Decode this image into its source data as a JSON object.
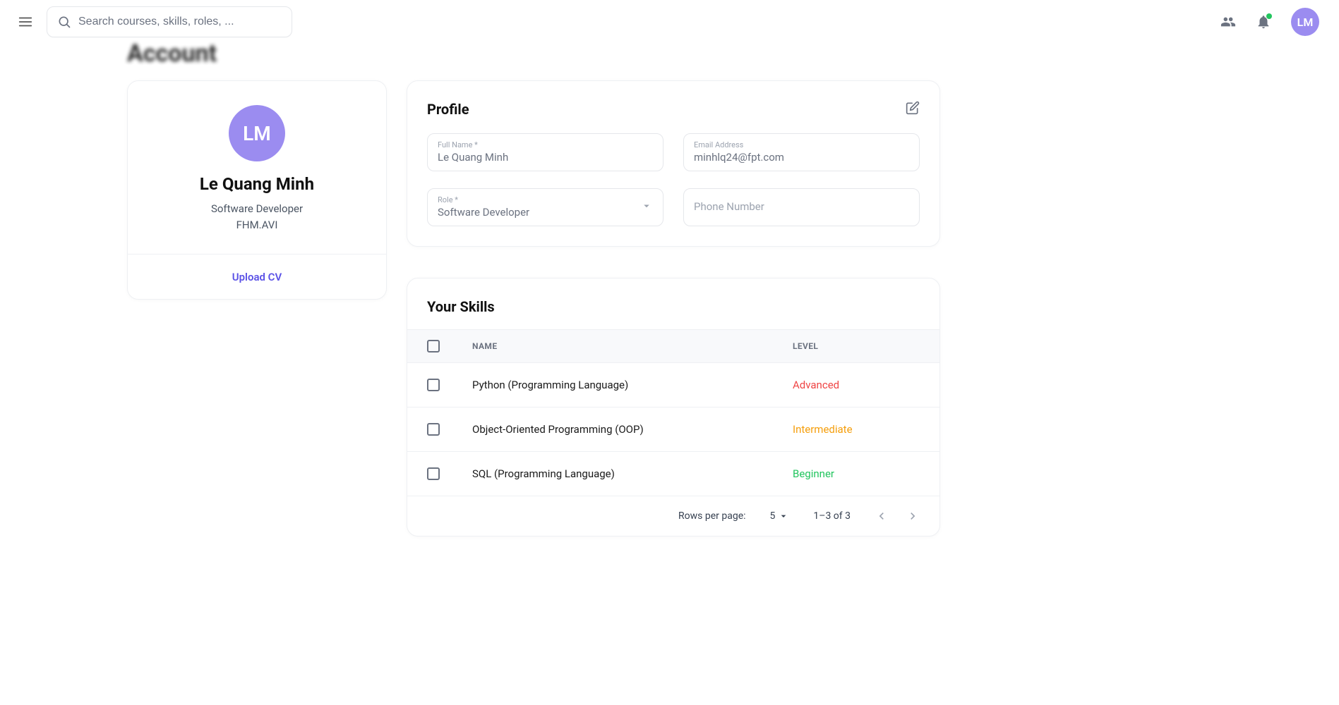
{
  "header": {
    "search_placeholder": "Search courses, skills, roles, ...",
    "avatar_initials": "LM"
  },
  "page": {
    "title": "Account"
  },
  "mini": {
    "avatar_initials": "LM",
    "name": "Le Quang Minh",
    "role": "Software Developer",
    "org": "FHM.AVI",
    "upload_label": "Upload CV"
  },
  "profile": {
    "title": "Profile",
    "full_name_label": "Full Name *",
    "full_name_value": "Le Quang Minh",
    "email_label": "Email Address",
    "email_value": "minhlq24@fpt.com",
    "role_label": "Role *",
    "role_value": "Software Developer",
    "phone_placeholder": "Phone Number"
  },
  "skills": {
    "title": "Your Skills",
    "columns": {
      "name": "NAME",
      "level": "LEVEL"
    },
    "rows": [
      {
        "name": "Python (Programming Language)",
        "level": "Advanced",
        "level_class": "level-advanced"
      },
      {
        "name": "Object-Oriented Programming (OOP)",
        "level": "Intermediate",
        "level_class": "level-intermediate"
      },
      {
        "name": "SQL (Programming Language)",
        "level": "Beginner",
        "level_class": "level-beginner"
      }
    ],
    "pager": {
      "rows_per_page_label": "Rows per page:",
      "rows_per_page_value": "5",
      "range_text": "1–3 of 3"
    }
  },
  "colors": {
    "accent": "#9b8cf0",
    "link": "#5b52e6",
    "advanced": "#ef4444",
    "intermediate": "#f59e0b",
    "beginner": "#22c55e"
  }
}
